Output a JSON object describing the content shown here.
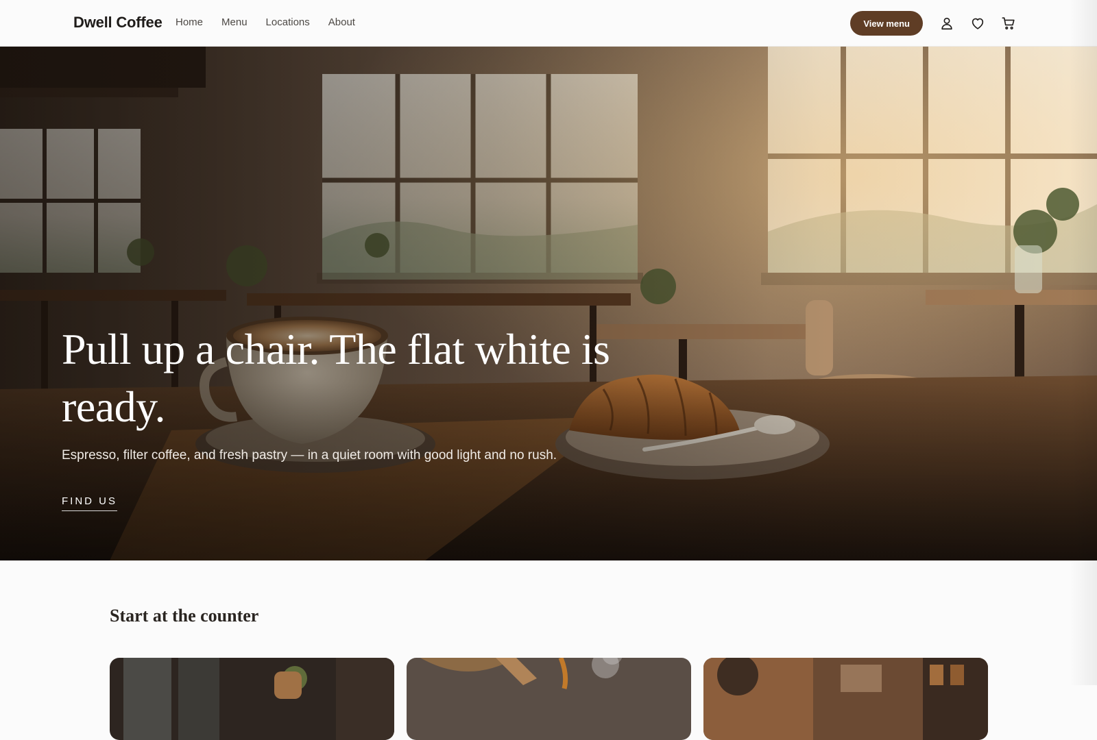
{
  "brand": {
    "name": "Dwell Coffee"
  },
  "nav": {
    "links": [
      "Home",
      "Menu",
      "Locations",
      "About"
    ],
    "cta_label": "View menu",
    "icons": [
      "user-icon",
      "heart-icon",
      "cart-icon"
    ]
  },
  "hero": {
    "title": "Pull up a chair. The flat white is ready.",
    "subtitle": "Espresso, filter coffee, and fresh pastry — in a quiet room with good light and no rush.",
    "link_label": "FIND US"
  },
  "section": {
    "title": "Start at the counter"
  },
  "colors": {
    "accent": "#5f3d25",
    "page_bg": "#fbfbfb",
    "text": "#2a2521"
  }
}
